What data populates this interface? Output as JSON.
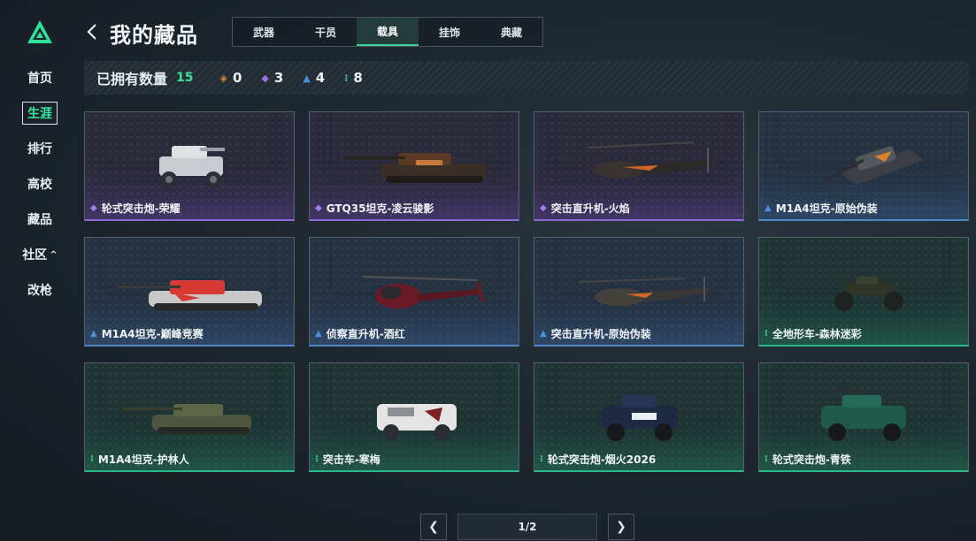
{
  "header": {
    "title": "我的藏品"
  },
  "sidebar": {
    "items": [
      {
        "label": "首页"
      },
      {
        "label": "生涯"
      },
      {
        "label": "排行"
      },
      {
        "label": "高校"
      },
      {
        "label": "藏品"
      },
      {
        "label": "社区"
      },
      {
        "label": "改枪"
      }
    ],
    "active_index": 1
  },
  "tabs": [
    {
      "label": "武器"
    },
    {
      "label": "干员"
    },
    {
      "label": "载具"
    },
    {
      "label": "挂饰"
    },
    {
      "label": "典藏"
    }
  ],
  "active_tab": 2,
  "counts": {
    "label": "已拥有数量",
    "total": "15",
    "stats": [
      {
        "icon": "orange-diamond-icon",
        "value": "0"
      },
      {
        "icon": "purple-diamond-icon",
        "value": "3"
      },
      {
        "icon": "blue-triangle-icon",
        "value": "4"
      },
      {
        "icon": "green-dots-icon",
        "value": "8"
      }
    ]
  },
  "colors": {
    "accent": "#39d49a",
    "purple": "#8a6ad8",
    "blue": "#4f86c6",
    "green": "#2fb58a",
    "orange": "#d8873a"
  },
  "items": [
    {
      "name": "轮式突击炮-荣耀",
      "rarity": "purple",
      "vehicle": "armored-car-icon"
    },
    {
      "name": "GTQ35坦克-凌云骏影",
      "rarity": "purple",
      "vehicle": "tank-icon"
    },
    {
      "name": "突击直升机-火焰",
      "rarity": "purple",
      "vehicle": "attack-helicopter-icon"
    },
    {
      "name": "M1A4坦克-原始伪装",
      "rarity": "blue",
      "vehicle": "tank-icon"
    },
    {
      "name": "M1A4坦克-巅峰竞赛",
      "rarity": "blue",
      "vehicle": "tank-icon"
    },
    {
      "name": "侦察直升机-酒红",
      "rarity": "blue",
      "vehicle": "scout-helicopter-icon"
    },
    {
      "name": "突击直升机-原始伪装",
      "rarity": "blue",
      "vehicle": "attack-helicopter-icon"
    },
    {
      "name": "全地形车-森林迷彩",
      "rarity": "green",
      "vehicle": "atv-icon"
    },
    {
      "name": "M1A4坦克-护林人",
      "rarity": "green",
      "vehicle": "tank-icon"
    },
    {
      "name": "突击车-寒梅",
      "rarity": "green",
      "vehicle": "armored-car-icon"
    },
    {
      "name": "轮式突击炮-烟火2026",
      "rarity": "green",
      "vehicle": "armored-car-icon"
    },
    {
      "name": "轮式突击炮-青铁",
      "rarity": "green",
      "vehicle": "armored-car-icon"
    }
  ],
  "pagination": {
    "label": "1/2"
  }
}
